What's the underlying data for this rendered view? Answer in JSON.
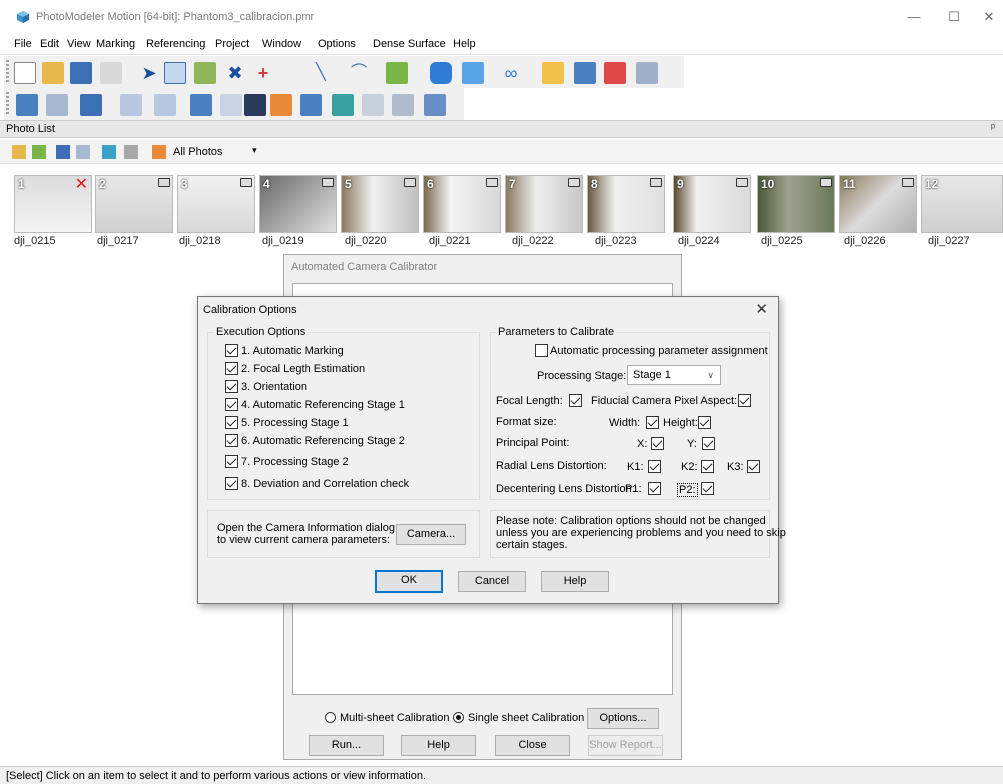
{
  "window": {
    "title": "PhotoModeler Motion [64-bit]: Phantom3_calibracion.pmr",
    "minimize": "—",
    "maximize": "☐",
    "close": "✕"
  },
  "menu": [
    "File",
    "Edit",
    "View",
    "Marking",
    "Referencing",
    "Project",
    "Window",
    "Options",
    "Dense Surface",
    "Help"
  ],
  "photo_list": {
    "title": "Photo List",
    "pin": "ᵖ",
    "filter": "All Photos",
    "photos": [
      {
        "num": "1",
        "label": "dji_0215"
      },
      {
        "num": "2",
        "label": "dji_0217"
      },
      {
        "num": "3",
        "label": "dji_0218"
      },
      {
        "num": "4",
        "label": "dji_0219"
      },
      {
        "num": "5",
        "label": "dji_0220"
      },
      {
        "num": "6",
        "label": "dji_0221"
      },
      {
        "num": "7",
        "label": "dji_0222"
      },
      {
        "num": "8",
        "label": "dji_0223"
      },
      {
        "num": "9",
        "label": "dji_0224"
      },
      {
        "num": "10",
        "label": "dji_0225"
      },
      {
        "num": "11",
        "label": "dji_0226"
      },
      {
        "num": "12",
        "label": "dji_0227"
      }
    ]
  },
  "calibrator": {
    "title": "Automated Camera Calibrator",
    "multi_sheet": "Multi-sheet Calibration",
    "single_sheet": "Single sheet Calibration",
    "options": "Options...",
    "run": "Run...",
    "help": "Help",
    "close": "Close",
    "show_report": "Show Report..."
  },
  "dialog": {
    "title": "Calibration Options",
    "close": "✕",
    "execution": {
      "label": "Execution Options",
      "items": [
        "1. Automatic Marking",
        "2. Focal Legth Estimation",
        "3. Orientation",
        "4. Automatic Referencing Stage 1",
        "5. Processing Stage 1",
        "6. Automatic Referencing Stage 2",
        "7. Processing Stage 2",
        "8. Deviation and Correlation check"
      ]
    },
    "params": {
      "label": "Parameters to Calibrate",
      "auto_assign": "Automatic processing parameter assignment",
      "stage_label": "Processing Stage:",
      "stage_value": "Stage 1",
      "focal_length": "Focal Length:",
      "fiducial": "Fiducial Camera Pixel Aspect:",
      "format_size": "Format size:",
      "width": "Width:",
      "height": "Height:",
      "principal": "Principal Point:",
      "x": "X:",
      "y": "Y:",
      "radial": "Radial Lens Distortion:",
      "k1": "K1:",
      "k2": "K2:",
      "k3": "K3:",
      "decentering": "Decentering Lens Distortion:",
      "p1": "P1:",
      "p2": "P2:"
    },
    "camera_info_line1": "Open the Camera Information dialog",
    "camera_info_line2": "to view current camera parameters:",
    "camera_button": "Camera...",
    "note_line1": "Please note: Calibration options should not be changed",
    "note_line2": "unless you are experiencing problems and you need to skip",
    "note_line3": "certain stages.",
    "ok": "OK",
    "cancel": "Cancel",
    "help": "Help"
  },
  "status": "[Select] Click on an item to select it and to perform various actions or view information."
}
